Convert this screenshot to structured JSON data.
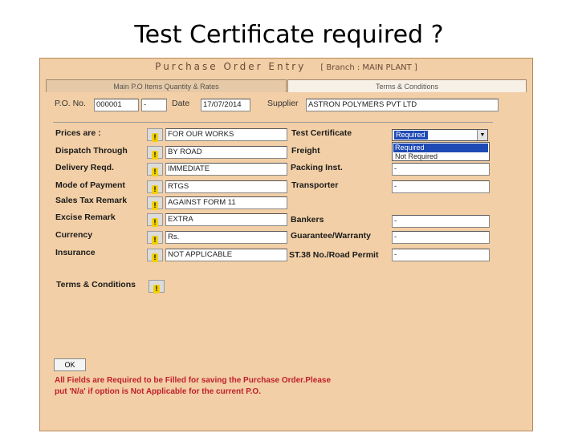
{
  "slide": {
    "title": "Test Certificate required ?"
  },
  "window": {
    "title": "Purchase Order Entry",
    "branch": "[ Branch : MAIN PLANT ]",
    "tabs": [
      "Main P.O Items  Quantity & Rates",
      "Terms & Conditions"
    ]
  },
  "header": {
    "po_label": "P.O. No.",
    "po_value": "000001",
    "po_suffix": "-",
    "date_label": "Date",
    "date_value": "17/07/2014",
    "supplier_label": "Supplier",
    "supplier_value": "ASTRON POLYMERS PVT LTD"
  },
  "left_fields": [
    {
      "label": "Prices are :",
      "value": "FOR OUR WORKS"
    },
    {
      "label": "Dispatch Through",
      "value": "BY ROAD"
    },
    {
      "label": "Delivery Reqd.",
      "value": "IMMEDIATE"
    },
    {
      "label": "Mode of Payment",
      "value": "RTGS"
    },
    {
      "label": "Sales Tax Remark",
      "value": "AGAINST FORM 11"
    },
    {
      "label": "Excise Remark",
      "value": "EXTRA"
    },
    {
      "label": "Currency",
      "value": "Rs."
    },
    {
      "label": "Insurance",
      "value": "NOT APPLICABLE"
    },
    {
      "label": "Terms & Conditions",
      "value": ""
    }
  ],
  "right_fields": [
    {
      "label": "Test Certificate",
      "value": "Required"
    },
    {
      "label": "Freight",
      "value": ""
    },
    {
      "label": "Packing Inst.",
      "value": "-"
    },
    {
      "label": "Transporter",
      "value": "-"
    },
    {
      "label": "Bankers",
      "value": "-"
    },
    {
      "label": "Guarantee/Warranty",
      "value": "-"
    },
    {
      "label": "ST.38 No./Road Permit",
      "value": "-"
    }
  ],
  "test_certificate_options": [
    "Required",
    "Not Required"
  ],
  "warn_glyph": "!",
  "combo_arrow": "▼",
  "ok_label": "OK",
  "message": "All Fields are Required to be Filled for saving the Purchase Order.Please put 'N/a' if option is Not Applicable for the current P.O."
}
